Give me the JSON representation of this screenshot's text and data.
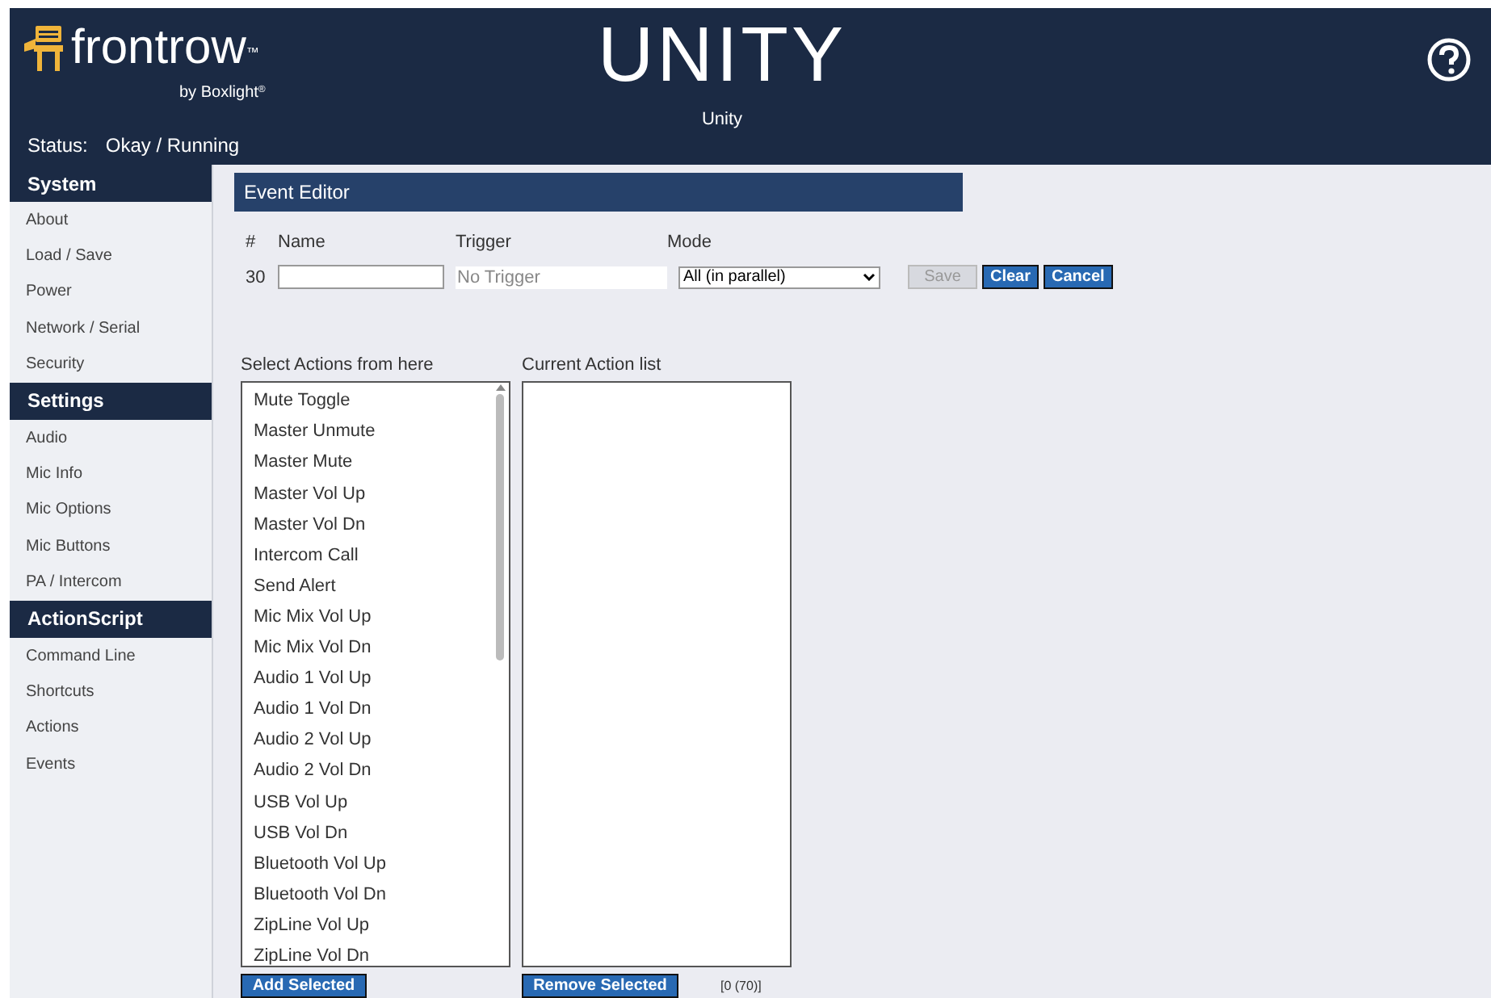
{
  "header": {
    "brand": "frontrow",
    "trademark": "™",
    "byline": "by Boxlight",
    "byline_mark": "®",
    "product": "UNITY",
    "subtitle": "Unity",
    "status_label": "Status:",
    "status_value": "Okay / Running"
  },
  "sidebar": [
    {
      "title": "System",
      "items": [
        "About",
        "Load / Save",
        "Power",
        "Network / Serial",
        "Security"
      ]
    },
    {
      "title": "Settings",
      "items": [
        "Audio",
        "Mic Info",
        "Mic Options",
        "Mic Buttons",
        "PA / Intercom"
      ]
    },
    {
      "title": "ActionScript",
      "items": [
        "Command Line",
        "Shortcuts",
        "Actions",
        "Events"
      ]
    }
  ],
  "editor": {
    "title": "Event Editor",
    "columns": [
      "#",
      "Name",
      "Trigger",
      "Mode"
    ],
    "number": "30",
    "trigger_placeholder": "No Trigger",
    "mode": "All (in parallel)",
    "buttons": [
      {
        "label": "Save",
        "disabled": true
      },
      {
        "label": "Clear",
        "disabled": false
      },
      {
        "label": "Cancel",
        "disabled": false
      }
    ]
  },
  "available": {
    "label": "Select Actions from here",
    "items": [
      "Mute Toggle",
      "Master Unmute",
      "Master Mute",
      "Master Vol Up",
      "Master Vol Dn",
      "Intercom Call",
      "Send Alert",
      "Mic Mix Vol Up",
      "Mic Mix Vol Dn",
      "Audio 1 Vol Up",
      "Audio 1 Vol Dn",
      "Audio 2 Vol Up",
      "Audio 2 Vol Dn",
      "USB Vol Up",
      "USB Vol Dn",
      "Bluetooth Vol Up",
      "Bluetooth Vol Dn",
      "ZipLine Vol Up",
      "ZipLine Vol Dn"
    ],
    "button": "Add Selected"
  },
  "current": {
    "label": "Current Action list",
    "button": "Remove Selected",
    "count": "[0 (70)]"
  }
}
